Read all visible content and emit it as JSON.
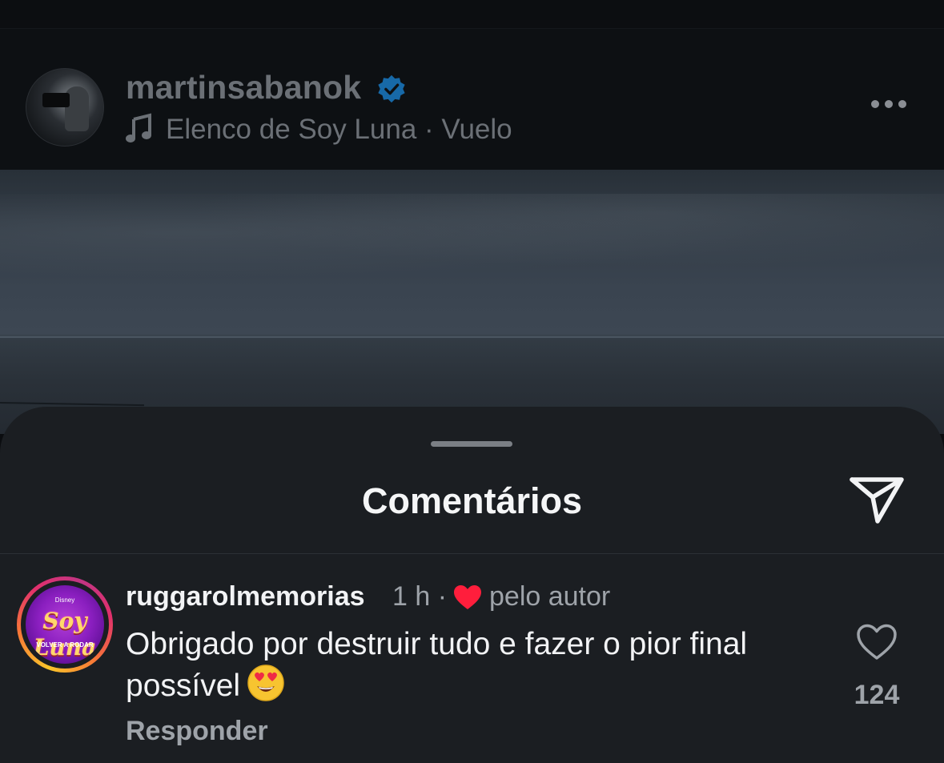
{
  "post": {
    "username": "martinsabanok",
    "verified": true,
    "music_line": "Elenco de Soy Luna · Vuelo",
    "icons": {
      "verified": "verified-badge-icon",
      "music": "music-note-icon",
      "more": "more-options-icon"
    }
  },
  "comments_sheet": {
    "title": "Comentários",
    "icons": {
      "share": "send-paper-plane-icon"
    }
  },
  "comment": {
    "username": "ruggarolmemorias",
    "time": "1 h ·",
    "liked_by_author_label": "pelo autor",
    "text": "Obrigado por destruir tudo e fazer o pior final possível",
    "emoji": "heart-eyes-emoji",
    "reply_label": "Responder",
    "like_count": "124",
    "avatar": {
      "brand_top": "Disney",
      "brand": "Soy Luna",
      "brand_sub": "VOLVER A RODAR"
    },
    "colors": {
      "author_heart": "#ff1e3c"
    }
  }
}
